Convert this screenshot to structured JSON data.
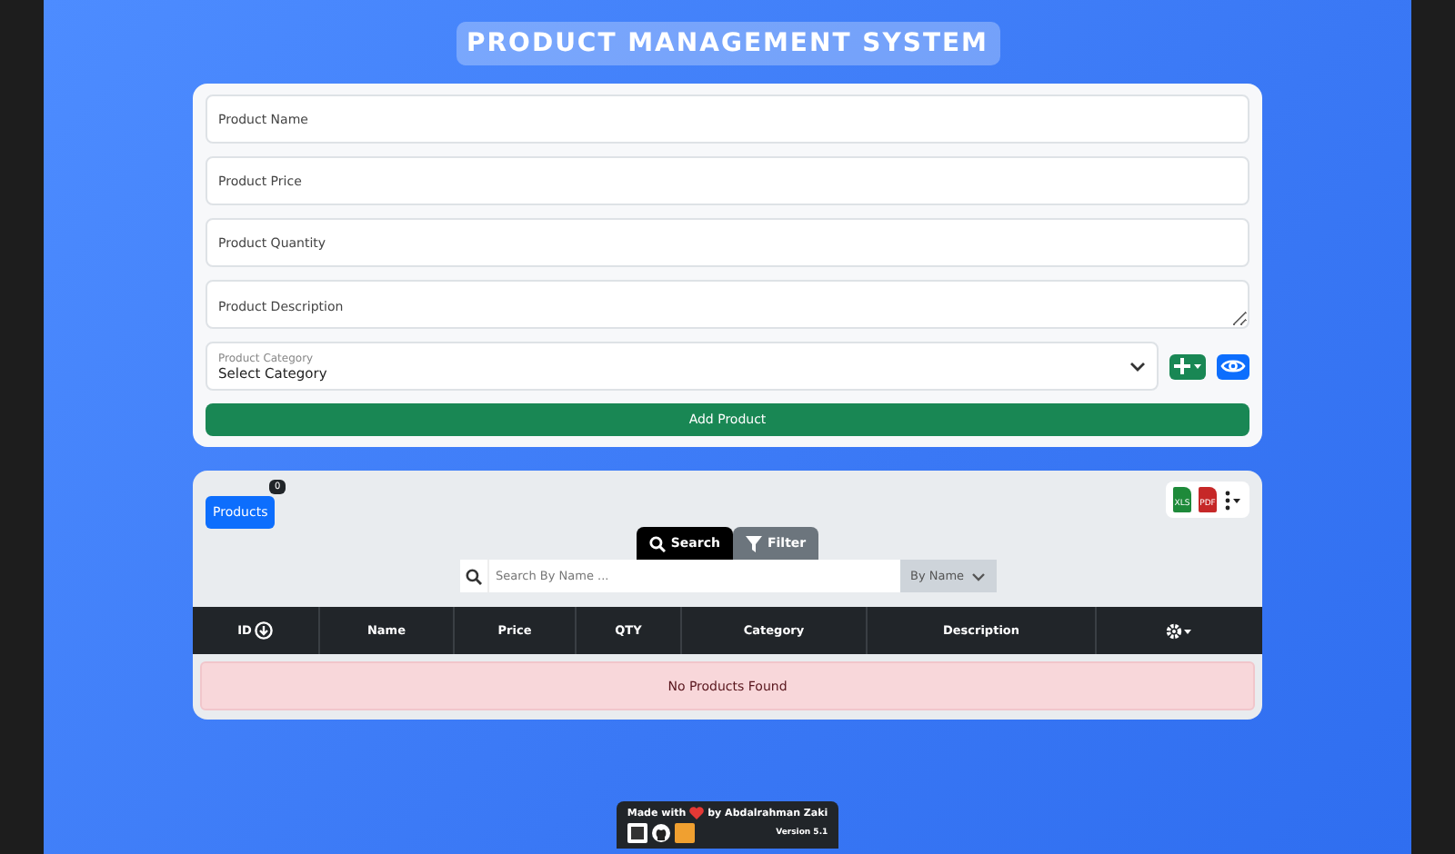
{
  "header": {
    "title": "PRODUCT MANAGEMENT SYSTEM"
  },
  "form": {
    "fields": [
      {
        "kind": "input",
        "placeholder": "Product Name"
      },
      {
        "kind": "input",
        "placeholder": "Product Price"
      },
      {
        "kind": "input",
        "placeholder": "Product Quantity"
      },
      {
        "kind": "textarea",
        "placeholder": "Product Description"
      }
    ],
    "category": {
      "label": "Product Category",
      "value": "Select Category"
    },
    "submit": "Add Product"
  },
  "table_panel": {
    "products_button": {
      "label": "Products",
      "count": "0"
    },
    "export": [
      {
        "label": "XLS",
        "color": "#1e8a3a"
      },
      {
        "label": "PDF",
        "color": "#c62828"
      }
    ],
    "modes": [
      {
        "label": "Search",
        "selected": true
      },
      {
        "label": "Filter",
        "selected": false
      }
    ],
    "search": {
      "placeholder": "Search By Name ...",
      "by": "By Name"
    },
    "columns": [
      "ID",
      "Name",
      "Price",
      "QTY",
      "Category",
      "Description"
    ],
    "empty_message": "No Products Found"
  },
  "footer": {
    "made_with": "Made with",
    "author": "by Abdalrahman Zaki",
    "version": "Version 5.1"
  }
}
